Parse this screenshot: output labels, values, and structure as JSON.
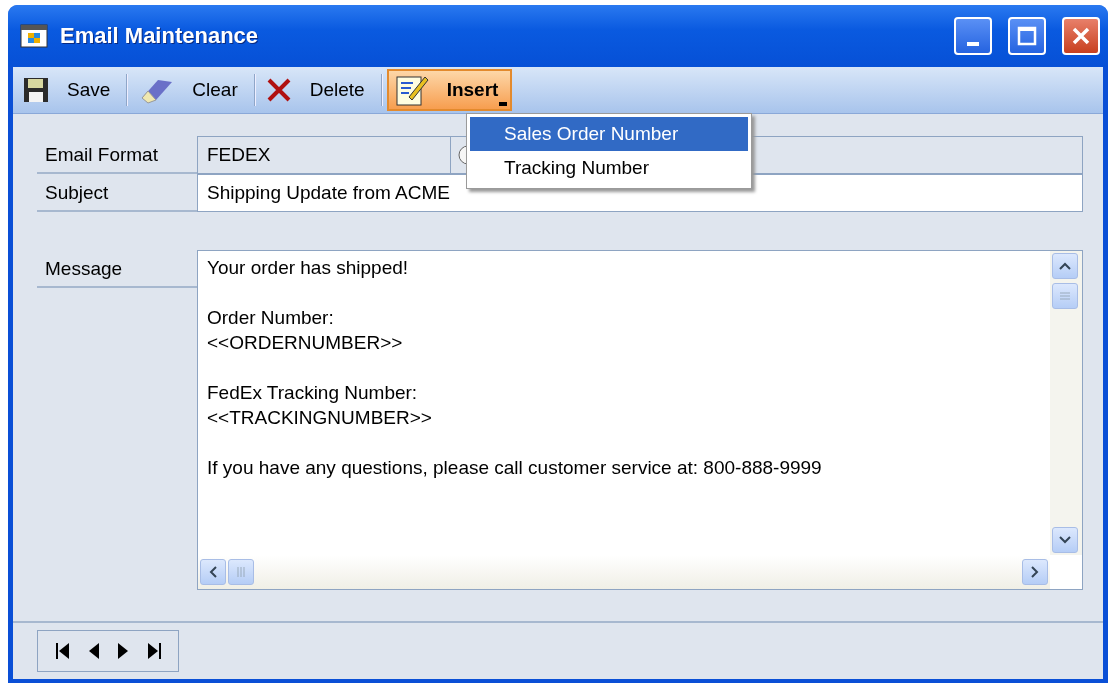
{
  "window": {
    "title": "Email Maintenance"
  },
  "toolbar": [
    {
      "kind": "save",
      "label": "Save",
      "open": false
    },
    {
      "kind": "clear",
      "label": "Clear",
      "open": false
    },
    {
      "kind": "delete",
      "label": "Delete",
      "open": false
    },
    {
      "kind": "insert",
      "label": "Insert",
      "open": true
    }
  ],
  "insert_menu": [
    {
      "label": "Sales Order Number",
      "selected": true
    },
    {
      "label": "Tracking Number",
      "selected": false
    }
  ],
  "fields": [
    {
      "label": "Email Format",
      "value": "FEDEX",
      "kind": "lookup"
    },
    {
      "label": "Subject",
      "value": "Shipping Update from ACME",
      "kind": "text"
    }
  ],
  "message": {
    "label": "Message",
    "paragraphs": [
      [
        "Your order has shipped!"
      ],
      [
        "Order Number:",
        "<<ORDERNUMBER>>"
      ],
      [
        "FedEx Tracking Number:",
        "<<TRACKINGNUMBER>>"
      ],
      [
        "If you have any questions, please call customer service at: 800-888-9999"
      ]
    ]
  }
}
